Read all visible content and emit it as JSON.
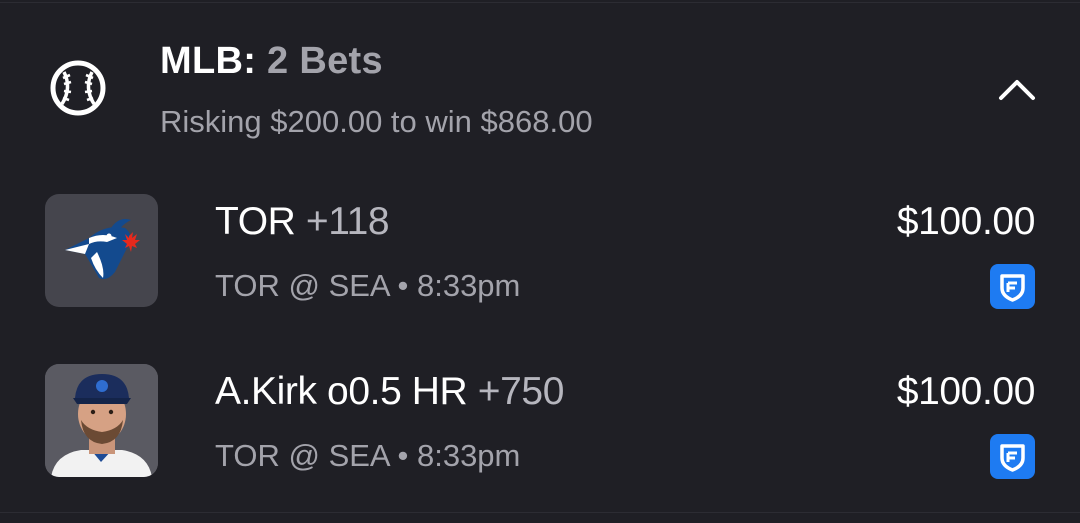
{
  "header": {
    "league": "MLB:",
    "bet_count": "2 Bets",
    "summary": "Risking $200.00 to win $868.00",
    "sport_icon": "baseball-icon",
    "collapse_icon": "chevron-up-icon"
  },
  "bets": [
    {
      "pick": "TOR",
      "odds": "+118",
      "matchup": "TOR @ SEA • 8:33pm",
      "amount": "$100.00",
      "thumb": "blue-jays-logo",
      "book_icon": "sportsbook-shield-icon"
    },
    {
      "pick": "A.Kirk o0.5 HR",
      "odds": "+750",
      "matchup": "TOR @ SEA • 8:33pm",
      "amount": "$100.00",
      "thumb": "player-headshot",
      "book_icon": "sportsbook-shield-icon"
    }
  ],
  "colors": {
    "background": "#1f1f25",
    "thumb_bg": "#45454d",
    "muted_text": "#a3a3ab",
    "book_badge": "#1e7bf2",
    "jays_blue": "#134a8e"
  }
}
